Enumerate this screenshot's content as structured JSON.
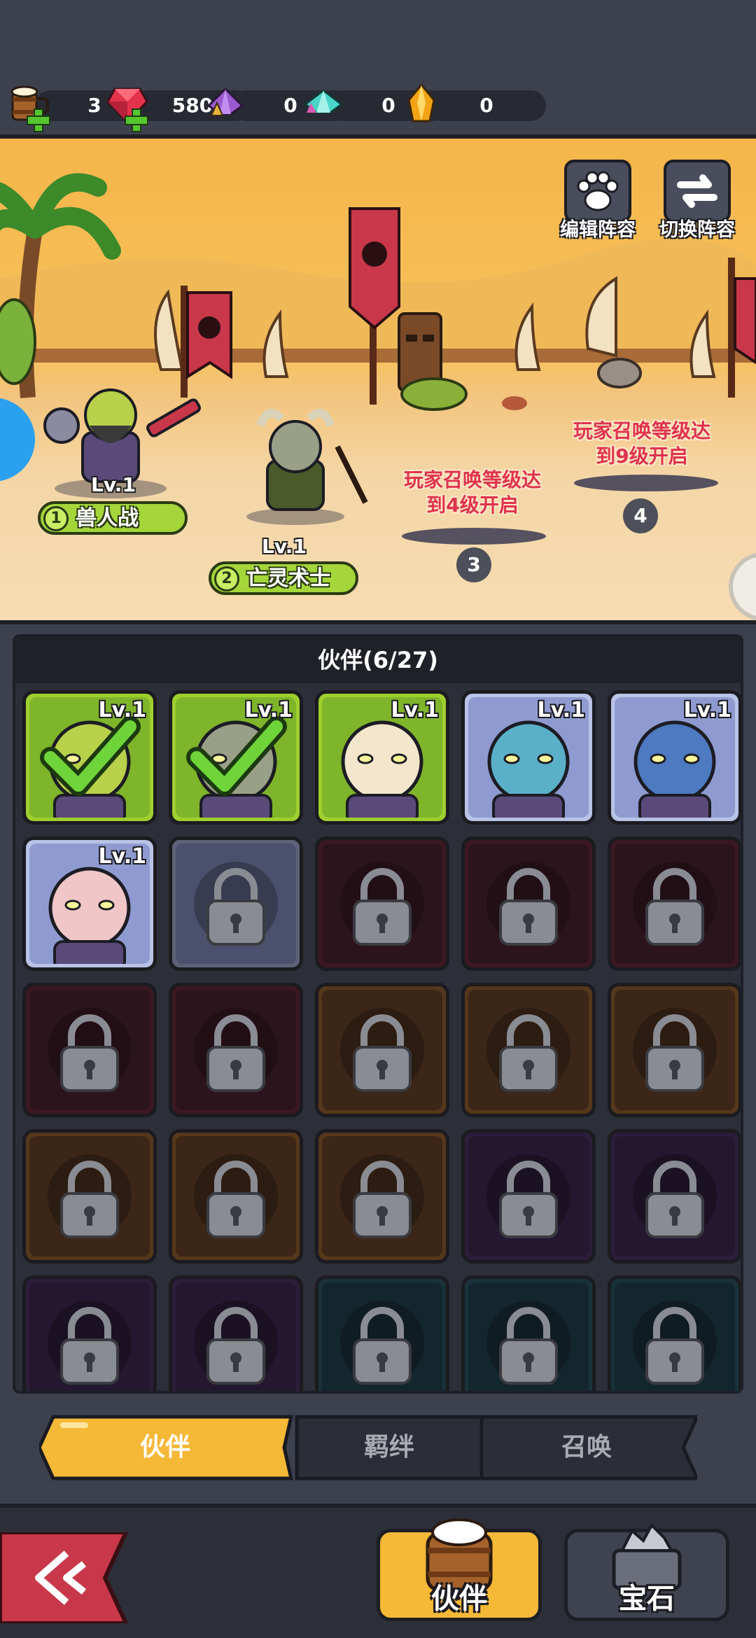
{
  "resources": [
    {
      "name": "beer-mug",
      "value": "3",
      "has_plus": true
    },
    {
      "name": "red-gem",
      "value": "580",
      "has_plus": true
    },
    {
      "name": "purple-crystal",
      "value": "0",
      "has_plus": false
    },
    {
      "name": "cyan-crystal",
      "value": "0",
      "has_plus": false
    },
    {
      "name": "orange-crystal",
      "value": "0",
      "has_plus": false
    }
  ],
  "top_buttons": {
    "edit_formation": "编辑阵容",
    "switch_formation": "切换阵容"
  },
  "formation": {
    "heroes": [
      {
        "slot": "1",
        "level": "Lv.1",
        "name": "兽人战"
      },
      {
        "slot": "2",
        "level": "Lv.1",
        "name": "亡灵术士"
      }
    ],
    "locked_slots": [
      {
        "slot": "3",
        "text_line1": "玩家召唤等级达",
        "text_line2": "到4级开启"
      },
      {
        "slot": "4",
        "text_line1": "玩家召唤等级达",
        "text_line2": "到9级开启"
      }
    ]
  },
  "panel": {
    "title": "伙伴(6/27)"
  },
  "cards": [
    {
      "level": "Lv.1",
      "unlocked": true,
      "selected": true,
      "frame": "green",
      "face": "orc"
    },
    {
      "level": "Lv.1",
      "unlocked": true,
      "selected": true,
      "frame": "green",
      "face": "undead"
    },
    {
      "level": "Lv.1",
      "unlocked": true,
      "selected": false,
      "frame": "green",
      "face": "paladin"
    },
    {
      "level": "Lv.1",
      "unlocked": true,
      "selected": false,
      "frame": "blue",
      "face": "troll"
    },
    {
      "level": "Lv.1",
      "unlocked": true,
      "selected": false,
      "frame": "blue",
      "face": "goblin"
    },
    {
      "level": "Lv.1",
      "unlocked": true,
      "selected": false,
      "frame": "blue",
      "face": "elf"
    },
    {
      "level": "",
      "unlocked": false,
      "frame": "blue"
    },
    {
      "level": "",
      "unlocked": false,
      "frame": "red"
    },
    {
      "level": "",
      "unlocked": false,
      "frame": "red"
    },
    {
      "level": "",
      "unlocked": false,
      "frame": "red"
    },
    {
      "level": "",
      "unlocked": false,
      "frame": "red"
    },
    {
      "level": "",
      "unlocked": false,
      "frame": "red"
    },
    {
      "level": "",
      "unlocked": false,
      "frame": "orange"
    },
    {
      "level": "",
      "unlocked": false,
      "frame": "orange"
    },
    {
      "level": "",
      "unlocked": false,
      "frame": "orange"
    },
    {
      "level": "",
      "unlocked": false,
      "frame": "orange"
    },
    {
      "level": "",
      "unlocked": false,
      "frame": "orange"
    },
    {
      "level": "",
      "unlocked": false,
      "frame": "orange"
    },
    {
      "level": "",
      "unlocked": false,
      "frame": "purple"
    },
    {
      "level": "",
      "unlocked": false,
      "frame": "purple"
    },
    {
      "level": "",
      "unlocked": false,
      "frame": "purple"
    },
    {
      "level": "",
      "unlocked": false,
      "frame": "purple"
    },
    {
      "level": "",
      "unlocked": false,
      "frame": "teal"
    },
    {
      "level": "",
      "unlocked": false,
      "frame": "teal"
    },
    {
      "level": "",
      "unlocked": false,
      "frame": "teal"
    }
  ],
  "tabs": [
    {
      "label": "伙伴",
      "active": true
    },
    {
      "label": "羁绊",
      "active": false
    },
    {
      "label": "召唤",
      "active": false
    }
  ],
  "bottom_nav": {
    "partner": "伙伴",
    "gem": "宝石"
  },
  "colors": {
    "frame_green": "#9fcf2f",
    "frame_blue": "#b9c3e6",
    "frame_red": "#6b1f2b",
    "frame_orange": "#a4651e",
    "frame_purple": "#4a2a63",
    "frame_teal": "#1f5a62",
    "tab_active": "#f5b837",
    "accent_red": "#c9384a"
  }
}
